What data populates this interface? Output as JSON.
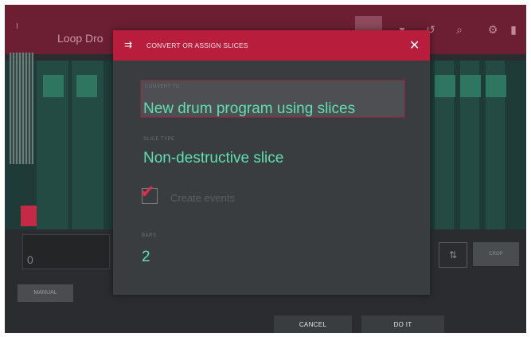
{
  "background_app": {
    "title": "Loop Dro",
    "logo": "Ⅰ",
    "lower_field_value": "0",
    "manual_label": "MANUAL",
    "right_box_label": "⇅",
    "right_button_label": "CROP"
  },
  "dialog": {
    "title": "CONVERT OR ASSIGN SLICES",
    "close_glyph": "✕",
    "icon_glyph": "⇉",
    "fields": {
      "convert_label": "CONVERT TO",
      "convert_value": "New drum program using slices",
      "type_label": "SLICE TYPE",
      "type_value": "Non-destructive slice",
      "create_events_label": "Create events",
      "create_events_checked": true,
      "bars_label": "BARS",
      "bars_value": "2"
    }
  },
  "footer": {
    "cancel_label": "CANCEL",
    "doit_label": "DO IT"
  },
  "colors": {
    "accent": "#b81d3b",
    "value_text": "#5fe0b0",
    "dialog_bg": "#3a3d40"
  },
  "icons": {
    "dialog_icon": "slice-convert-icon",
    "close_icon": "close-icon",
    "check_icon": "checkmark-icon",
    "search_icon": "search-icon",
    "settings_icon": "gear-icon"
  }
}
